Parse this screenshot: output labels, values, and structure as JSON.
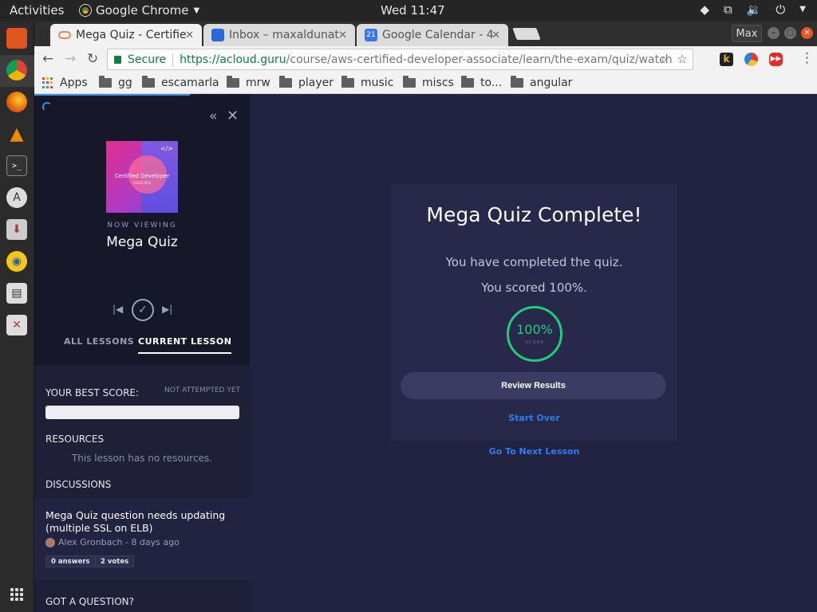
{
  "topbar": {
    "activities": "Activities",
    "app_name": "Google Chrome",
    "clock": "Wed 11:47"
  },
  "browser": {
    "tabs": [
      {
        "title": "Mega Quiz - Certifie",
        "favicon_color": "#f08a4b"
      },
      {
        "title": "Inbox – maxaldunat",
        "favicon_color": "#2a6ad8"
      },
      {
        "title": "Google Calendar - 4",
        "favicon_color": "#3b78e7"
      }
    ],
    "max_label": "Max",
    "secure_label": "Secure",
    "url_host": "https://acloud.guru",
    "url_path": "/course/aws-certified-developer-associate/learn/the-exam/quiz/watch",
    "bookmarks": {
      "apps": "Apps",
      "folders": [
        "gg",
        "escamarla",
        "mrw",
        "player",
        "music",
        "miscs",
        "to...",
        "angular"
      ]
    }
  },
  "sidebar": {
    "thumbnail": {
      "title": "Certified Developer",
      "subtitle": "ASSOCIATE",
      "code_icon": "</>"
    },
    "now_viewing_label": "NOW VIEWING",
    "lesson_title": "Mega Quiz",
    "tabs": {
      "all": "ALL LESSONS",
      "current": "CURRENT LESSON"
    },
    "best_score_label": "YOUR BEST SCORE:",
    "best_score_status": "NOT ATTEMPTED YET",
    "resources_label": "RESOURCES",
    "resources_empty": "This lesson has no resources.",
    "discussions_label": "DISCUSSIONS",
    "discussion": {
      "title": "Mega Quiz question needs updating (multiple SSL on ELB)",
      "author_line": "Alex Gronbach - 8 days ago",
      "answers": "0 answers",
      "votes": "2 votes"
    },
    "got_question": "GOT A QUESTION?"
  },
  "quiz": {
    "title": "Mega Quiz Complete!",
    "line1": "You have completed the quiz.",
    "line2": "You scored 100%.",
    "score_value": "100%",
    "score_label": "SCORE",
    "score_percent": 100,
    "review_button": "Review Results",
    "start_over": "Start Over",
    "next_lesson": "Go To Next Lesson"
  },
  "colors": {
    "accent_green": "#1ecf7a",
    "link_blue": "#2f7cf6",
    "page_bg": "#222340"
  }
}
